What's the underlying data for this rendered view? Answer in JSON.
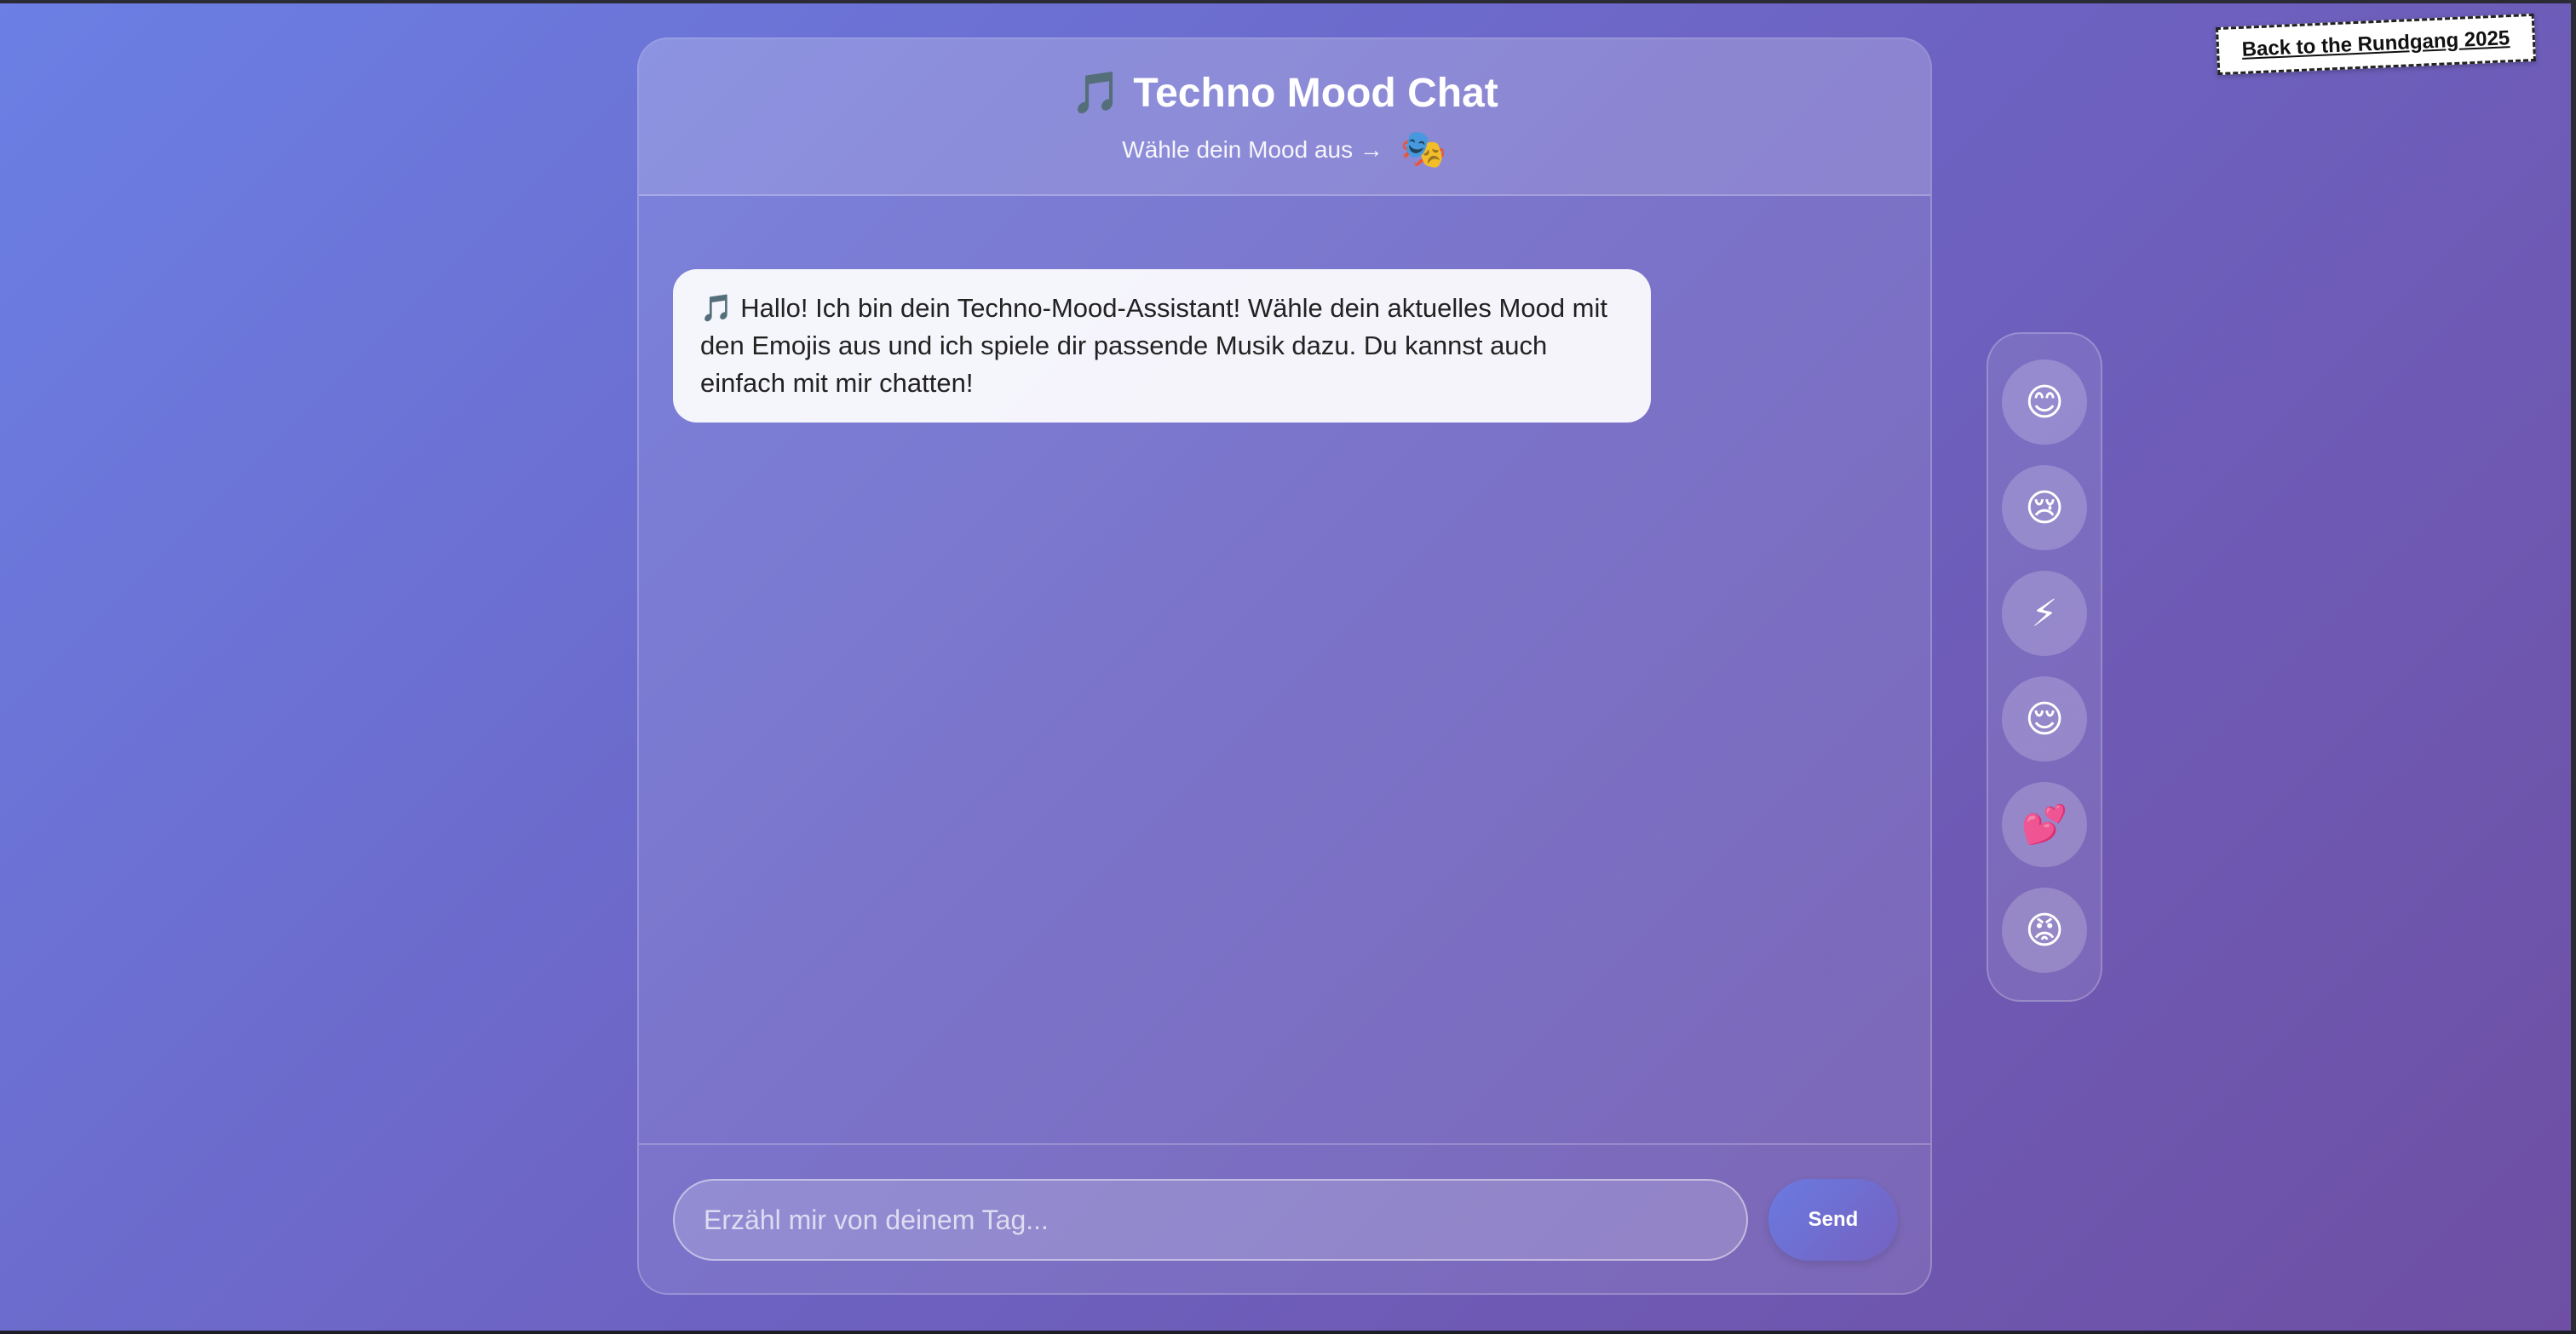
{
  "back_link": {
    "label": "Back to the Rundgang 2025"
  },
  "header": {
    "title": "🎵 Techno Mood Chat",
    "subtitle": "Wähle dein Mood aus →",
    "subtitle_icon": "🎭"
  },
  "messages": [
    {
      "sender": "bot",
      "text": "🎵 Hallo! Ich bin dein Techno-Mood-Assistant! Wähle dein aktuelles Mood mit den Emojis aus und ich spiele dir passende Musik dazu. Du kannst auch einfach mit mir chatten!"
    }
  ],
  "input": {
    "placeholder": "Erzähl mir von deinem Tag...",
    "value": ""
  },
  "send_button": {
    "label": "Send"
  },
  "moods": [
    {
      "emoji": "😊",
      "icon": "happy-face-icon"
    },
    {
      "emoji": "😢",
      "icon": "crying-face-icon"
    },
    {
      "emoji": "⚡",
      "icon": "lightning-icon"
    },
    {
      "emoji": "😌",
      "icon": "relieved-face-icon"
    },
    {
      "emoji": "💕",
      "icon": "two-hearts-icon"
    },
    {
      "emoji": "😡",
      "icon": "angry-face-icon"
    }
  ],
  "colors": {
    "background_start": "#6b7fe4",
    "background_end": "#6e4fa3",
    "send_button": "#6a7ae0"
  }
}
